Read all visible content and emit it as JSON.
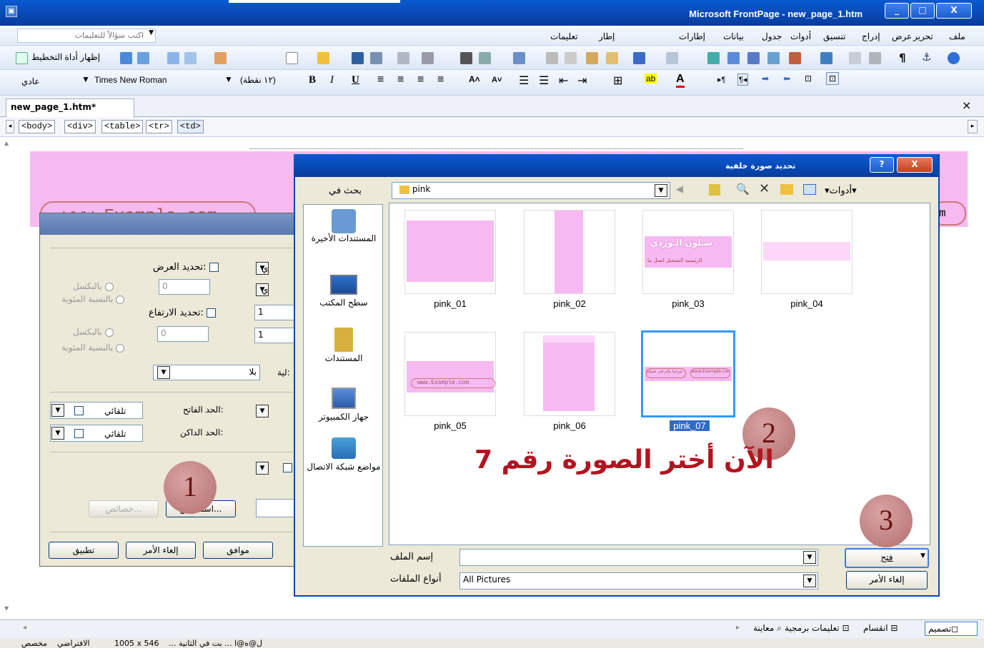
{
  "window": {
    "title": "Microsoft FrontPage - new_page_1.htm",
    "controls": [
      "_",
      "□",
      "X"
    ]
  },
  "menu": {
    "items": [
      "ملف",
      "تحرير",
      "عرض",
      "إدراج",
      "تنسيق",
      "أدوات",
      "جدول",
      "بيانات",
      "إطارات",
      "إطار",
      "تعليمات"
    ],
    "ask_placeholder": "اكتب سؤالاً للتعليمات"
  },
  "toolbar2": {
    "layout_tool": "إظهار أداة التخطيط"
  },
  "format": {
    "style": "عادي",
    "font": "Times New Roman",
    "size": "(١٢ نقطة)"
  },
  "doc": {
    "tab": "new_page_1.htm*",
    "close": "×",
    "tags": [
      "<body>",
      "<div>",
      "<table>",
      "<tr>",
      "<td>"
    ],
    "band_url": "www.Example.com",
    "band_right": "m"
  },
  "props_dialog": {
    "width_label": "تحديد العرض:",
    "height_label": "تحديد الارتفاع:",
    "px": "بالبكسل",
    "pct": "بالنسبة المئوية",
    "zero": "0",
    "one": "1",
    "bala": "بلا",
    "wrap_label": "لية:",
    "light_border": "الحد الفاتح:",
    "dark_border": "الحد الداكن:",
    "auto": "تلقائي",
    "browse": "استعراض...",
    "properties": "خصائص...",
    "ok": "موافق",
    "cancel": "إلغاء الأمر",
    "apply": "تطبيق",
    "fragment": "ي"
  },
  "file_dialog": {
    "title": "تحديد صورة خلفية",
    "look_in_label": "بحث في",
    "look_in_value": "pink",
    "tools": "أدوات",
    "places": [
      "المستندات الأخيرة",
      "سطح المكتب",
      "المستندات",
      "جهاز الكمبيوتر",
      "مواضع شبكة الاتصال"
    ],
    "files": [
      "pink_01",
      "pink_02",
      "pink_03",
      "pink_04",
      "pink_05",
      "pink_06",
      "pink_07"
    ],
    "selected": "pink_07",
    "thumb_text": {
      "p3_title": "شـلون الـوردي",
      "p3_links": "الرئيسية  التسجيل  اتصل بنا",
      "p5_url": "www.Example.com",
      "p7_text": "مرحبا بكم في شبكة",
      "p7_url": "www.Example.com"
    },
    "filename_label": "إسم الملف",
    "filetype_label": "أنواع الملفات",
    "filetype_value": "All Pictures",
    "open": "فتح",
    "cancel": "إلغاء الأمر",
    "help": "?",
    "close": "X"
  },
  "annotations": {
    "step1": "1",
    "step2": "2",
    "step3": "3",
    "instruction": "الآن أختر الصورة رقم 7"
  },
  "views": {
    "design": "تصميم",
    "split": "انقسام",
    "code": "تعليمات برمجية",
    "preview": "معاينة"
  },
  "status": {
    "dims": "1005 x 546",
    "left": "الافتراضي",
    "text": "... ل@ه@ا ... بت في الثانية",
    "custom": "مخصص"
  },
  "colors": {
    "pink": "#f7b9f2",
    "title_blue": "#0848b3",
    "highlight": "#3399ff",
    "instruction_red": "#b3131f"
  }
}
